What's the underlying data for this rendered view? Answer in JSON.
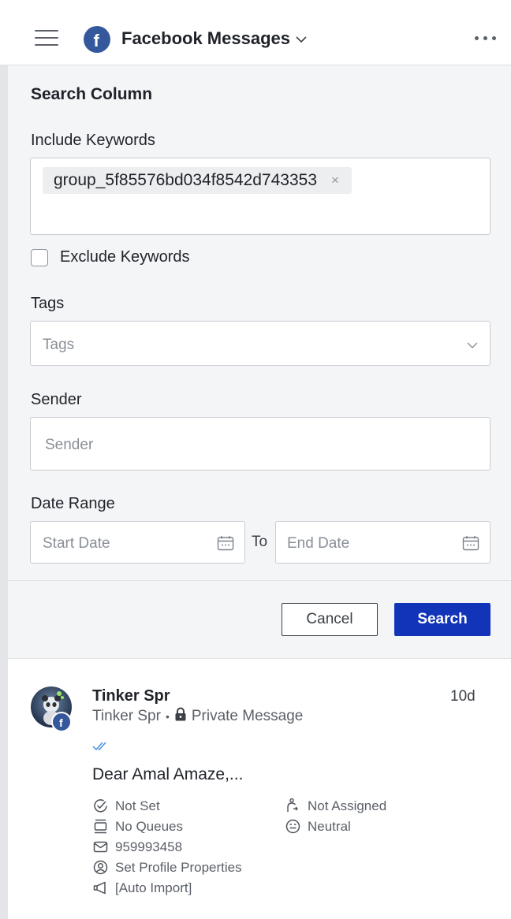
{
  "header": {
    "title": "Facebook Messages",
    "brand_color": "#34589b"
  },
  "search": {
    "title": "Search Column",
    "include_label": "Include Keywords",
    "keyword_chip": "group_5f85576bd034f8542d743353",
    "chip_remove": "×",
    "exclude_label": "Exclude Keywords",
    "exclude_checked": false,
    "tags_label": "Tags",
    "tags_placeholder": "Tags",
    "sender_label": "Sender",
    "sender_placeholder": "Sender",
    "date_label": "Date Range",
    "start_placeholder": "Start Date",
    "to_text": "To",
    "end_placeholder": "End Date",
    "cancel_label": "Cancel",
    "search_label": "Search",
    "accent_color": "#1134b8"
  },
  "message": {
    "sender": "Tinker Spr",
    "sub_sender": "Tinker Spr",
    "bullet": "•",
    "channel": "Private Message",
    "time": "10d",
    "status_icon": "double-check-icon",
    "snippet": "Dear Amal Amaze,...",
    "status": "Not Set",
    "queues": "No Queues",
    "account_id": "959993458",
    "profile_action": "Set Profile Properties",
    "campaign": "[Auto Import]",
    "assignment": "Not Assigned",
    "sentiment": "Neutral"
  }
}
